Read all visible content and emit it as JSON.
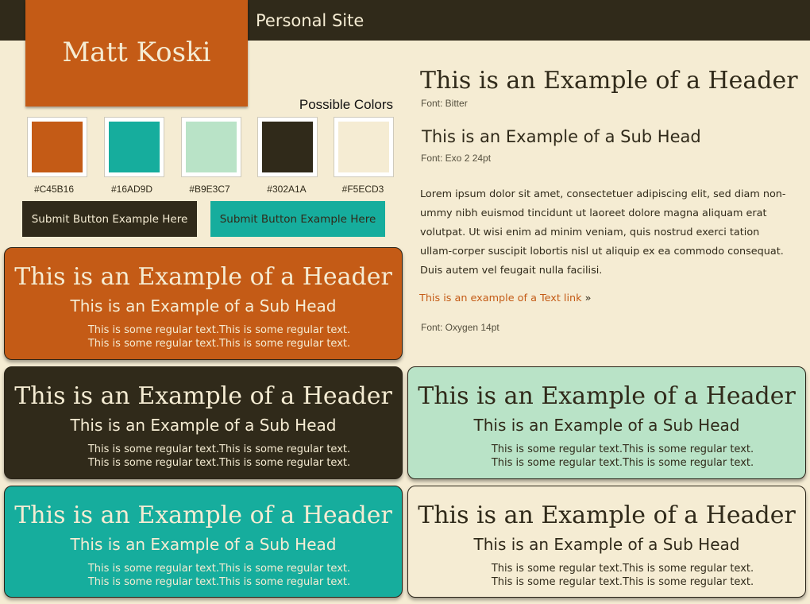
{
  "header": {
    "site_title": "Personal Site"
  },
  "logo": {
    "name": "Matt Koski"
  },
  "palette": {
    "label": "Possible Colors",
    "colors": [
      "#C45B16",
      "#16AD9D",
      "#B9E3C7",
      "#302A1A",
      "#F5ECD3"
    ]
  },
  "buttons": {
    "dark_label": "Submit Button Example Here",
    "teal_label": "Submit Button Example Here"
  },
  "type_sample": {
    "header": "This is an Example of a Header",
    "header_font": "Font: Bitter",
    "subhead": "This is an Example of a Sub Head",
    "subhead_font": "Font: Exo 2  24pt",
    "body": "Lorem ipsum dolor sit amet, consectetuer adipiscing elit, sed diam non-ummy nibh euismod tincidunt ut laoreet dolore magna aliquam erat volutpat. Ut wisi enim ad minim veniam, quis nostrud exerci tation ullam-corper suscipit lobortis nisl ut aliquip ex ea commodo consequat. Duis autem vel feugait nulla facilisi.",
    "link_text": "This is an example of a Text link",
    "link_suffix": "»",
    "body_font": "Font: Oxygen 14pt"
  },
  "cards": [
    {
      "bg": "#C45B16",
      "fg": "#F5ECD3",
      "header": "This is an Example of a Header",
      "subhead": "This is an Example of a Sub Head",
      "line1": "This is some regular text.This is some regular text.",
      "line2": "This is some regular text.This is some regular text."
    },
    {
      "bg": "#302A1A",
      "fg": "#F5ECD3",
      "header": "This is an Example of a Header",
      "subhead": "This is an Example of a Sub Head",
      "line1": "This is some regular text.This is some regular text.",
      "line2": "This is some regular text.This is some regular text."
    },
    {
      "bg": "#B9E3C7",
      "fg": "#302A1A",
      "header": "This is an Example of a Header",
      "subhead": "This is an Example of a Sub Head",
      "line1": "This is some regular text.This is some regular text.",
      "line2": "This is some regular text.This is some regular text."
    },
    {
      "bg": "#16AD9D",
      "fg": "#F5ECD3",
      "header": "This is an Example of a Header",
      "subhead": "This is an Example of a Sub Head",
      "line1": "This is some regular text.This is some regular text.",
      "line2": "This is some regular text.This is some regular text."
    },
    {
      "bg": "#F5ECD3",
      "fg": "#302A1A",
      "header": "This is an Example of a Header",
      "subhead": "This is an Example of a Sub Head",
      "line1": "This is some regular text.This is some regular text.",
      "line2": "This is some regular text.This is some regular text."
    }
  ]
}
